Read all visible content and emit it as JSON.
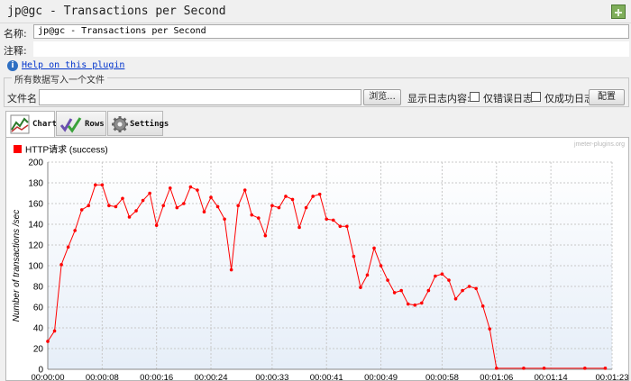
{
  "window": {
    "title": "jp@gc - Transactions per Second"
  },
  "form": {
    "name_label": "名称:",
    "name_value": "jp@gc - Transactions per Second",
    "comment_label": "注释:",
    "help_link": "Help on this plugin"
  },
  "file_panel": {
    "group_title": "所有数据写入一个文件",
    "filename_label": "文件名",
    "browse_button": "浏览...",
    "log_content_label": "显示日志内容:",
    "errors_only_label": "仅错误日志",
    "success_only_label": "仅成功日志",
    "configure_button": "配置"
  },
  "tabs": [
    {
      "label": "Chart",
      "icon": "chart-icon",
      "active": true
    },
    {
      "label": "Rows",
      "icon": "checkmarks-icon",
      "active": false
    },
    {
      "label": "Settings",
      "icon": "gear-icon",
      "active": false
    }
  ],
  "watermark": "jmeter-plugins.org",
  "colors": {
    "series": "#ff0000",
    "grid": "#c8c8c8",
    "plot_bg_top": "#ffffff",
    "plot_bg_bottom": "#e6eef8"
  },
  "chart_data": {
    "type": "line",
    "title": "",
    "xlabel": "",
    "ylabel": "Number of transactions /sec",
    "legend_placement": "top-left",
    "grid": true,
    "ylim": [
      0,
      200
    ],
    "xlim": [
      0,
      83
    ],
    "y_ticks": [
      0,
      20,
      40,
      60,
      80,
      100,
      120,
      140,
      160,
      180,
      200
    ],
    "x_ticks": [
      {
        "value": 0,
        "label": "00:00:00"
      },
      {
        "value": 8,
        "label": "00:00:08"
      },
      {
        "value": 16,
        "label": "00:00:16"
      },
      {
        "value": 24,
        "label": "00:00:24"
      },
      {
        "value": 33,
        "label": "00:00:33"
      },
      {
        "value": 41,
        "label": "00:00:41"
      },
      {
        "value": 49,
        "label": "00:00:49"
      },
      {
        "value": 58,
        "label": "00:00:58"
      },
      {
        "value": 66,
        "label": "00:01:06"
      },
      {
        "value": 74,
        "label": "00:01:14"
      },
      {
        "value": 83,
        "label": "00:01:23"
      }
    ],
    "series": [
      {
        "name": "HTTP请求 (success)",
        "points": [
          [
            0,
            27
          ],
          [
            1,
            37
          ],
          [
            2,
            101
          ],
          [
            3,
            118
          ],
          [
            4,
            134
          ],
          [
            5,
            154
          ],
          [
            6,
            158
          ],
          [
            7,
            178
          ],
          [
            8,
            178
          ],
          [
            9,
            158
          ],
          [
            10,
            157
          ],
          [
            11,
            165
          ],
          [
            12,
            147
          ],
          [
            13,
            153
          ],
          [
            14,
            163
          ],
          [
            15,
            170
          ],
          [
            16,
            139
          ],
          [
            17,
            158
          ],
          [
            18,
            175
          ],
          [
            19,
            156
          ],
          [
            20,
            160
          ],
          [
            21,
            176
          ],
          [
            22,
            173
          ],
          [
            23,
            152
          ],
          [
            24,
            166
          ],
          [
            25,
            157
          ],
          [
            26,
            145
          ],
          [
            27,
            96
          ],
          [
            28,
            158
          ],
          [
            29,
            173
          ],
          [
            30,
            149
          ],
          [
            31,
            146
          ],
          [
            32,
            129
          ],
          [
            33,
            158
          ],
          [
            34,
            156
          ],
          [
            35,
            167
          ],
          [
            36,
            164
          ],
          [
            37,
            137
          ],
          [
            38,
            156
          ],
          [
            39,
            167
          ],
          [
            40,
            169
          ],
          [
            41,
            145
          ],
          [
            42,
            144
          ],
          [
            43,
            138
          ],
          [
            44,
            138
          ],
          [
            45,
            109
          ],
          [
            46,
            79
          ],
          [
            47,
            91
          ],
          [
            48,
            117
          ],
          [
            49,
            100
          ],
          [
            50,
            86
          ],
          [
            51,
            74
          ],
          [
            52,
            76
          ],
          [
            53,
            63
          ],
          [
            54,
            62
          ],
          [
            55,
            64
          ],
          [
            56,
            76
          ],
          [
            57,
            90
          ],
          [
            58,
            92
          ],
          [
            59,
            86
          ],
          [
            60,
            68
          ],
          [
            61,
            76
          ],
          [
            62,
            80
          ],
          [
            63,
            78
          ],
          [
            64,
            61
          ],
          [
            65,
            39
          ],
          [
            66,
            1
          ],
          [
            70,
            1
          ],
          [
            73,
            1
          ],
          [
            79,
            1
          ],
          [
            82,
            1
          ]
        ]
      }
    ]
  }
}
